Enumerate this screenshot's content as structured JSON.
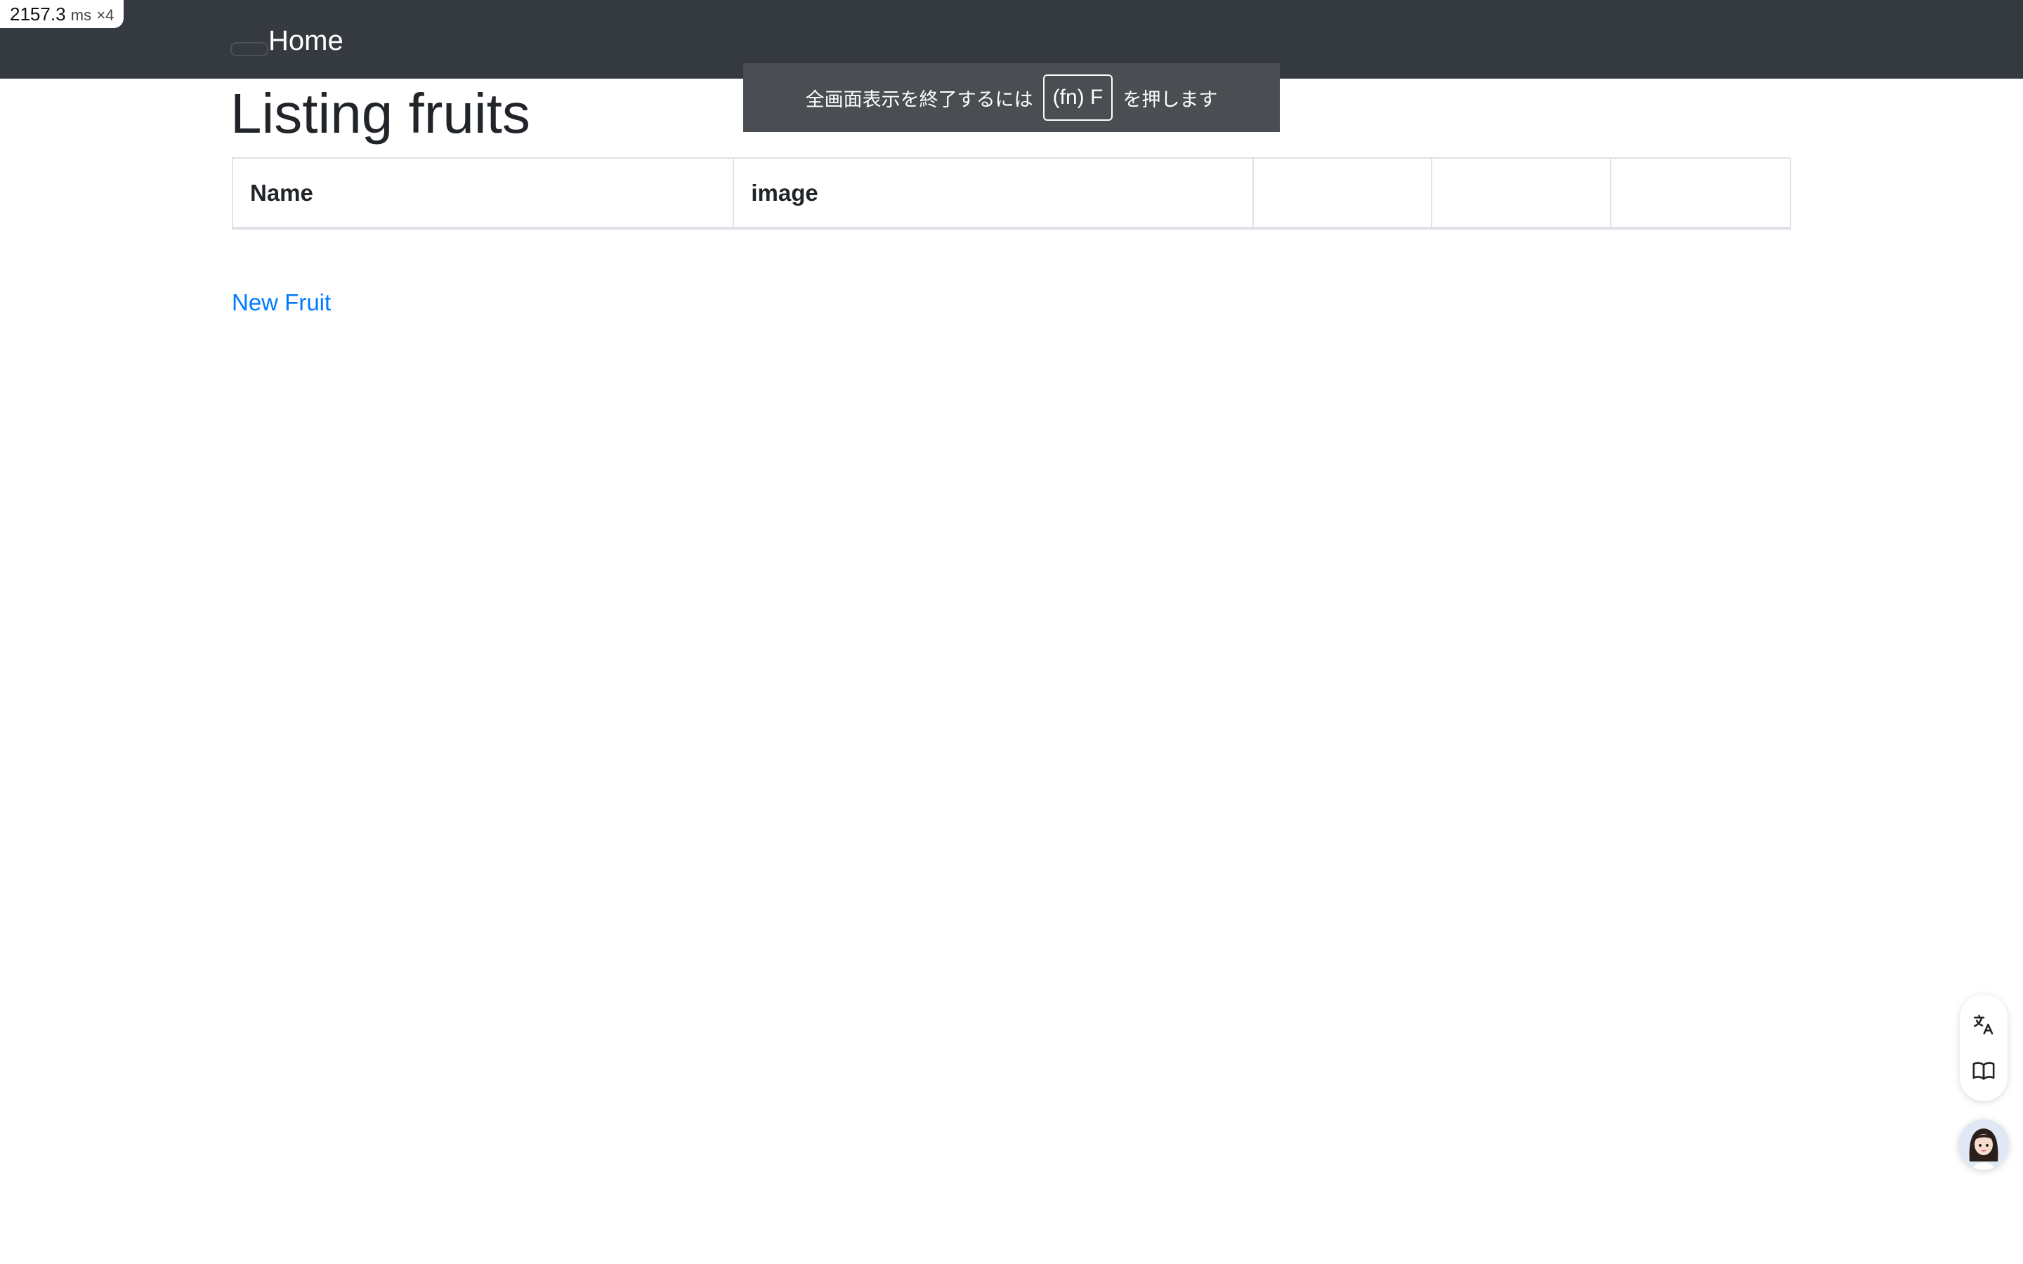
{
  "overlay": {
    "timing_value": "2157.3",
    "timing_unit": "ms",
    "timing_multiplier": "×4"
  },
  "navbar": {
    "brand": "Home",
    "toggler_icon": "hamburger-icon"
  },
  "fullscreen_banner": {
    "prefix": "全画面表示を終了するには",
    "key": "(fn) F",
    "suffix": "を押します"
  },
  "main": {
    "title": "Listing fruits",
    "table": {
      "headers": [
        "Name",
        "image",
        "",
        "",
        ""
      ]
    },
    "new_link": "New Fruit"
  },
  "side_toolbar": {
    "icons": [
      "translate-icon",
      "book-icon"
    ],
    "avatar": "assistant-avatar"
  },
  "colors": {
    "navbar_bg": "#343a40",
    "link": "#007bff",
    "banner_bg": "#4a4d51"
  }
}
